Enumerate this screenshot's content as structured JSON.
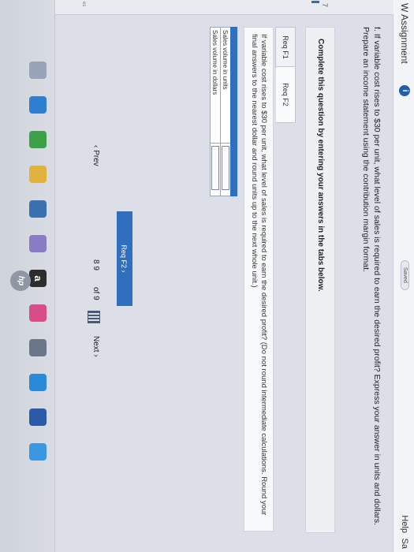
{
  "header": {
    "title": "W Assignment",
    "info_badge": "i",
    "saved_label": "Saved",
    "help_label": "Help",
    "save_label": "Sa"
  },
  "rail": {
    "question_number": "7",
    "label": "es"
  },
  "question": {
    "text": "f. If variable cost rises to $30 per unit, what level of sales is required to earn the desired profit? Express your answer in units and dollars. Prepare an income statement using the contribution margin format."
  },
  "panel": {
    "text": "Complete this question by entering your answers in the tabs below."
  },
  "tabs": [
    {
      "label": "Req F1",
      "active": false
    },
    {
      "label": "Req F2",
      "active": true
    }
  ],
  "instruction": {
    "text": "If variable cost rises to $30 per unit, what level of sales is required to earn the desired profit? (Do not round intermediate calculations. Round your final answers to the nearest dollar and round units up to the next whole unit.)"
  },
  "answers_table": {
    "rows": [
      {
        "label": "Sales volume in units",
        "value": ""
      },
      {
        "label": "Sales volume in dollars",
        "value": ""
      }
    ]
  },
  "buttons": {
    "req_f2": "Req F2",
    "req_f2_chevron": "›"
  },
  "pager": {
    "prev_label": "Prev",
    "prev_chevron": "‹",
    "current_pages": "8  9",
    "of_label": "of 9",
    "next_label": "Next",
    "next_chevron": "›"
  },
  "dock": {
    "icons": [
      {
        "name": "search-dock-icon",
        "color": "#9aa4b8"
      },
      {
        "name": "edge-dock-icon",
        "color": "#2f7fd0"
      },
      {
        "name": "chrome-dock-icon",
        "color": "#3fa04a"
      },
      {
        "name": "files-dock-icon",
        "color": "#e2b23e"
      },
      {
        "name": "store-dock-icon",
        "color": "#3a6fb0"
      },
      {
        "name": "mail-dock-icon",
        "color": "#8a7cc4"
      },
      {
        "name": "amazon-dock-icon",
        "color": "#2d2d2d"
      },
      {
        "name": "photos-dock-icon",
        "color": "#d84c8a"
      },
      {
        "name": "settings-dock-icon",
        "color": "#6b7688"
      },
      {
        "name": "ie-dock-icon",
        "color": "#2a8ad8"
      },
      {
        "name": "word-dock-icon",
        "color": "#2b5ba8"
      },
      {
        "name": "cortana-dock-icon",
        "color": "#3a98e0"
      }
    ],
    "amazon_glyph": "a",
    "hp_logo": "hp"
  },
  "colors": {
    "accent": "#2f6fbe",
    "background": "#dcdfe7"
  }
}
